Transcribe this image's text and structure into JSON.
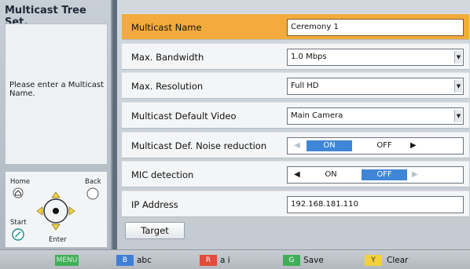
{
  "sidebar": {
    "title": "Multicast Tree Set.",
    "message": "Please enter a Multicast Name.",
    "remote": {
      "home": "Home",
      "back": "Back",
      "start": "Start",
      "enter": "Enter"
    }
  },
  "settings": {
    "rows": [
      {
        "label": "Multicast Name",
        "value": "Ceremony 1",
        "type": "text",
        "selected": true
      },
      {
        "label": "Max. Bandwidth",
        "value": "1.0 Mbps",
        "type": "dropdown"
      },
      {
        "label": "Max. Resolution",
        "value": "Full HD",
        "type": "dropdown"
      },
      {
        "label": "Multicast Default Video",
        "value": "Main Camera",
        "type": "dropdown"
      },
      {
        "label": "Multicast Def. Noise reduction",
        "on": "ON",
        "off": "OFF",
        "state": "ON",
        "type": "toggle"
      },
      {
        "label": "MIC detection",
        "on": "ON",
        "off": "OFF",
        "state": "OFF",
        "type": "toggle"
      },
      {
        "label": "IP Address",
        "value": "192.168.181.110",
        "type": "text"
      }
    ],
    "target_button": "Target"
  },
  "bottom_bar": {
    "keys": [
      {
        "key": "MENU",
        "label": "",
        "color": "#3fae57"
      },
      {
        "key": "B",
        "label": "abc",
        "color": "#3f7fd6"
      },
      {
        "key": "R",
        "label": "a i",
        "color": "#e24a3a"
      },
      {
        "key": "G",
        "label": "Save",
        "color": "#3fae57"
      },
      {
        "key": "Y",
        "label": "Clear",
        "color": "#f2d13c"
      }
    ]
  },
  "colors": {
    "selected_row": "#f2ab3c",
    "toggle_active": "#3f86d6"
  }
}
